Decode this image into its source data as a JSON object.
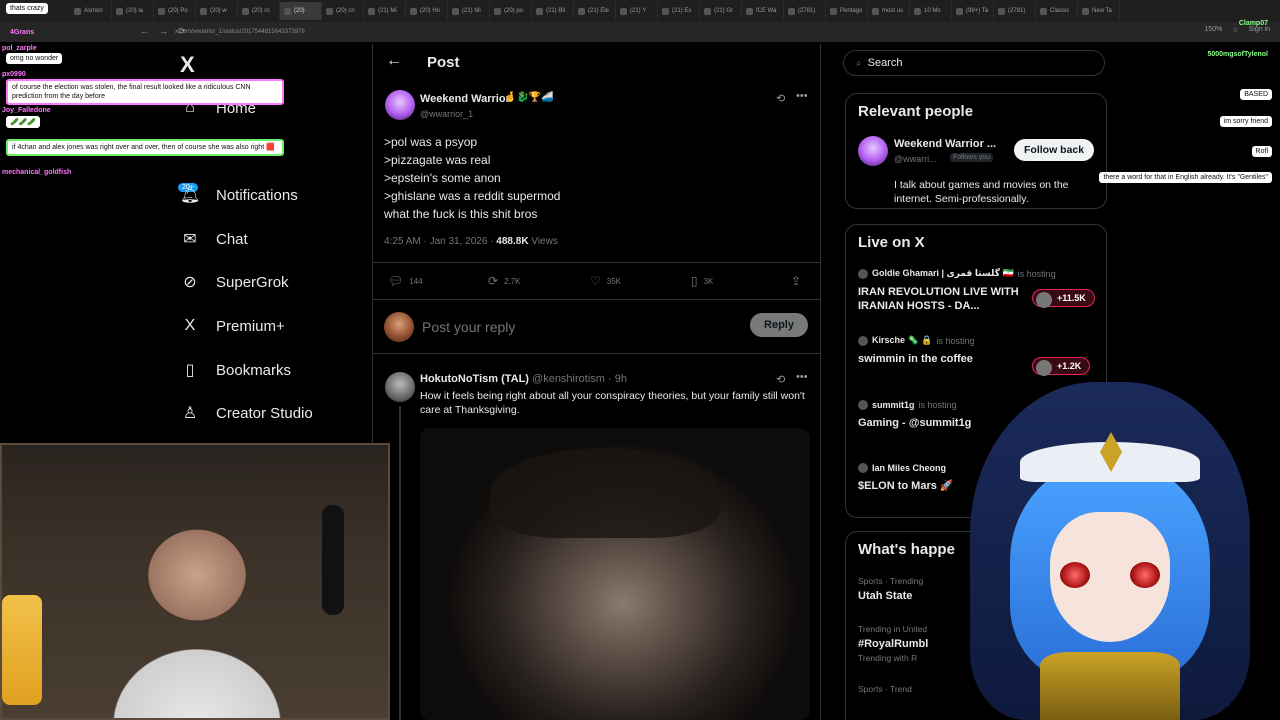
{
  "browser": {
    "tabs": [
      "Asmon",
      "(20) la",
      "(20) Po",
      "(20) w",
      "(20) ro",
      "(20)",
      "(20) cri",
      "(21) Mi",
      "(20) Ho",
      "(21) Mi",
      "(20) po",
      "(21) Bli",
      "(21) Ele",
      "(21) Y",
      "(21) Ex",
      "(21) Gr",
      "ICE Wa",
      "(2781)",
      "Pentago",
      "most us",
      "10 Mo",
      "(99+) Ta",
      "(2781)",
      "Classic",
      "New Ta"
    ],
    "active_tab_index": 5,
    "url": "x.com/wwarrior_1/status/2017544815643373979",
    "zoom": "150%",
    "sign_in": "Sign in"
  },
  "nav": {
    "home": "Home",
    "notifications": "Notifications",
    "notifications_badge": "20+",
    "chat": "Chat",
    "supergrok": "SuperGrok",
    "premium": "Premium+",
    "bookmarks": "Bookmarks",
    "creator_studio": "Creator Studio"
  },
  "post": {
    "header_title": "Post",
    "author_name": "Weekend Warrior",
    "author_emojis": "🤞🐉🏆🚄",
    "author_handle": "@wwarrior_1",
    "lines": [
      ">pol was a psyop",
      ">pizzagate was real",
      ">epstein's some anon",
      ">ghislane was a reddit supermod",
      "what the fuck is this shit bros"
    ],
    "timestamp": "4:25 AM · Jan 31, 2026",
    "views_count": "488.8K",
    "views_label": "Views",
    "replies": "144",
    "reposts": "2.7K",
    "likes": "35K",
    "bookmarks": "3K",
    "reply_placeholder": "Post your reply",
    "reply_button": "Reply"
  },
  "reply": {
    "name": "HokutoNoTism (TAL)",
    "handle_time": "@kenshirotism · 9h",
    "text": "How it feels being right about all your conspiracy theories, but your family still won't care at Thanksgiving."
  },
  "sidebar": {
    "search_placeholder": "Search",
    "relevant_title": "Relevant people",
    "rp_name": "Weekend Warrior ...",
    "rp_handle": "@wwarri...",
    "rp_follows": "Follows you",
    "follow_back": "Follow back",
    "rp_bio": "I talk about games and movies on the internet. Semi-professionally.",
    "live_title": "Live on X",
    "live": [
      {
        "host": "Goldie Ghamari | گلستا قمری 🇮🇷",
        "status": "is hosting",
        "title": "IRAN REVOLUTION LIVE WITH IRANIAN HOSTS - DA...",
        "count": "+11.5K"
      },
      {
        "host": "Kirsche 🦠 🔒",
        "status": "is hosting",
        "title": "swimmin in the coffee",
        "count": "+1.2K"
      },
      {
        "host": "summit1g",
        "status": "is hosting",
        "title": "Gaming - @summit1g",
        "count": ""
      },
      {
        "host": "Ian Miles Cheong",
        "status": "",
        "title": "$ELON to Mars 🚀",
        "count": ""
      }
    ],
    "happening_title": "What's happe",
    "trends": [
      {
        "meta": "Sports · Trending",
        "name": "Utah State"
      },
      {
        "meta": "Trending in United",
        "name": "#RoyalRumbl",
        "sub": "Trending with R"
      },
      {
        "meta": "Sports · Trend",
        "name": ""
      }
    ]
  },
  "chat_left": [
    {
      "user": "",
      "text": "thats crazy"
    },
    {
      "user": "4Grans",
      "text": ""
    },
    {
      "user": "",
      "text": "omg no wonder"
    },
    {
      "user": "pol_zarple",
      "text": ""
    },
    {
      "user": "px0990",
      "text": "of course the election was stolen, the final result looked like a ridiculous CNN prediction from the day before"
    },
    {
      "user": "Joy_Falledone",
      "text": "🥒🥒🥒"
    },
    {
      "user": "",
      "text": "if 4chan and alex jones was right over and over, then of course she was also right 🟥"
    },
    {
      "user": "mechanical_goldfish",
      "text": ""
    }
  ],
  "chat_right": [
    {
      "user": "Clamp07",
      "text": ""
    },
    {
      "user": "5000mgsofTylenol",
      "text": ""
    },
    {
      "user": "",
      "text": "BASED"
    },
    {
      "user": "",
      "text": "im sorry friend"
    },
    {
      "user": "",
      "text": "Rofl"
    },
    {
      "user": "",
      "text": "there a word for that in English already. It's \"Gentiles\""
    }
  ]
}
